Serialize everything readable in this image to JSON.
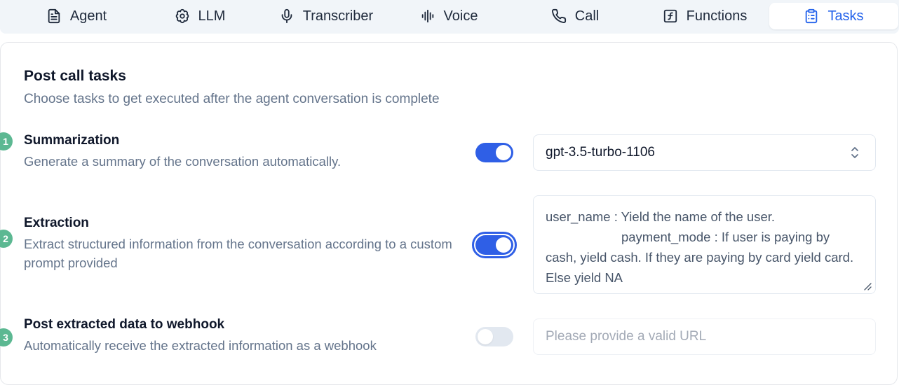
{
  "tabs": [
    {
      "label": "Agent",
      "icon": "file-text-icon"
    },
    {
      "label": "LLM",
      "icon": "brain-icon"
    },
    {
      "label": "Transcriber",
      "icon": "mic-icon"
    },
    {
      "label": "Voice",
      "icon": "audio-lines-icon"
    },
    {
      "label": "Call",
      "icon": "phone-icon"
    },
    {
      "label": "Functions",
      "icon": "function-icon"
    },
    {
      "label": "Tasks",
      "icon": "clipboard-icon",
      "active": true
    }
  ],
  "section": {
    "title": "Post call tasks",
    "subtitle": "Choose tasks to get executed after the agent conversation is complete"
  },
  "tasks": [
    {
      "step": "1",
      "title": "Summarization",
      "description": "Generate a summary of the conversation automatically.",
      "enabled": true,
      "model": "gpt-3.5-turbo-1106"
    },
    {
      "step": "2",
      "title": "Extraction",
      "description": "Extract structured information from the conversation according to a custom prompt provided",
      "enabled": true,
      "prompt": "user_name : Yield the name of the user.\n                     payment_mode : If user is paying by cash, yield cash. If they are paying by card yield card. Else yield NA"
    },
    {
      "step": "3",
      "title": "Post extracted data to webhook",
      "description": "Automatically receive the extracted information as a webhook",
      "enabled": false,
      "url_value": "",
      "url_placeholder": "Please provide a valid URL"
    }
  ],
  "colors": {
    "accent": "#2563eb",
    "toggle_on": "#2f5fe6",
    "toggle_off": "#e2e8f0",
    "badge": "#5cb892",
    "muted_text": "#64748b"
  }
}
